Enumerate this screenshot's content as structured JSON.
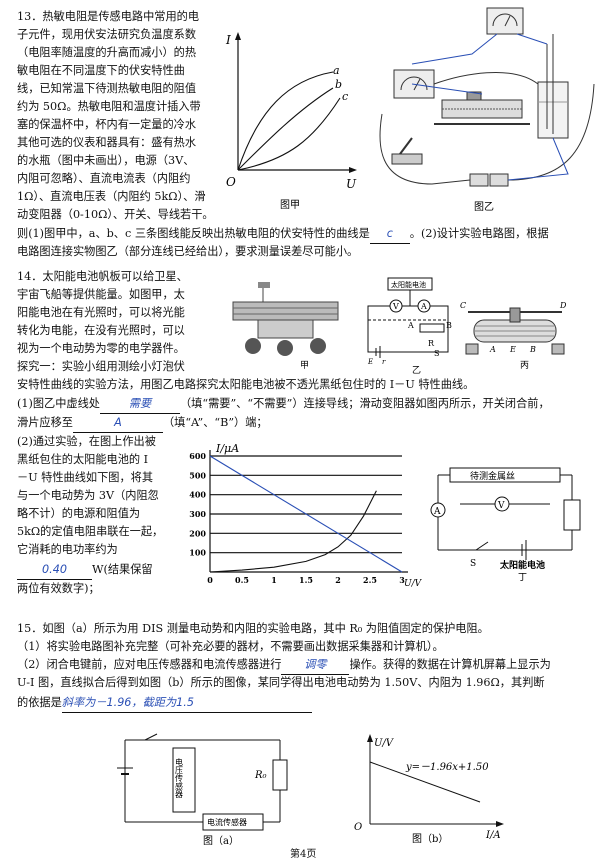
{
  "q13": {
    "lines": [
      "13．热敏电阻是传感电路中常用的电",
      "子元件，现用伏安法研究负温度系数",
      "（电阻率随温度的升高而减小）的热",
      "敏电阻在不同温度下的伏安特性曲",
      "线，已知常温下待测热敏电阻的阻值",
      "约为 50Ω。热敏电阻和温度计插入带",
      "塞的保温杯中，杯内有一定量的冷水",
      "其他可选的仪表和器具有：盛有热水",
      "的水瓶（图中未画出），电源（3V、",
      "内阻可忽略）、直流电流表（内阻约",
      "1Ω）、直流电压表（内阻约 5kΩ）、滑",
      "动变阻器（0-10Ω）、开关、导线若干。"
    ],
    "line13a": "则(1)图甲中，a、b、c 三条图线能反映出热敏电阻的伏安特性的曲线是",
    "answer1": "c",
    "line13a_tail": "。(2)设计实验电路图，根据",
    "line13b": "电路图连接实物图乙（部分连线已经给出），要求测量误差尽可能小。",
    "fig_jia": {
      "ylabel": "I",
      "xlabel": "U",
      "origin": "O",
      "curve_a": "a",
      "curve_b": "b",
      "curve_c": "c",
      "caption": "图甲"
    },
    "fig_yi": {
      "caption": "图乙"
    }
  },
  "q14": {
    "lines": [
      "14．太阳能电池帆板可以给卫星、",
      "宇宙飞船等提供能量。如图甲，太",
      "阳能电池在有光照时，可以将光能",
      "转化为电能，在没有光照时，可以",
      "视为一个电动势为零的电学器件。",
      "探究一：实验小组用测绘小灯泡伏"
    ],
    "line_full": "安特性曲线的实验方法，用图乙电路探究太阳能电池被不透光黑纸包住时的 I－U 特性曲线。",
    "p1_a": "(1)图乙中虚线处",
    "p1_ans": "需要",
    "p1_b": "（填“需要”、“不需要”）连接导线；滑动变阻器如图丙所示，开关闭合前，",
    "p1_c": "滑片应移至",
    "p1_ans2": "A",
    "p1_d": "（填“A”、“B”）端；",
    "p2_lines": [
      "(2)通过实验，在图上作出被",
      "黑纸包住的太阳能电池的 I",
      "－U 特性曲线如下图，将其",
      "与一个电动势为 3V（内阻忽",
      "略不计）的电源和阻值为",
      "5kΩ的定值电阻串联在一起，",
      "它消耗的电功率约为"
    ],
    "p2_ans": "0.40",
    "p2_tail": "W(结果保留",
    "p2_last": "两位有效数字)；",
    "fig_labels": {
      "jia": "甲",
      "yi": "乙",
      "bing": "丙",
      "ding": "丁",
      "box_title": "太阳能电池",
      "wire_title": "待测金属丝",
      "solar": "太阳能电池",
      "S": "S",
      "R": "R",
      "E": "E",
      "r": "r",
      "A": "A",
      "B": "B",
      "C": "C",
      "D": "D",
      "V": "V",
      "Am": "A"
    },
    "chart_labels": {
      "ylabel": "I/μA",
      "xlabel": "U/V",
      "origin": "0"
    }
  },
  "chart_data": {
    "type": "line",
    "title": "",
    "xlabel": "U/V",
    "ylabel": "I/μA",
    "xlim": [
      0,
      3
    ],
    "ylim": [
      0,
      600
    ],
    "xticks": [
      "0",
      "0.5",
      "1",
      "1.5",
      "2",
      "2.5",
      "3"
    ],
    "yticks": [
      "100",
      "200",
      "300",
      "400",
      "500",
      "600"
    ],
    "grid": true,
    "series": [
      {
        "values_x": [
          0,
          0.5,
          1.0,
          1.5,
          1.8,
          2.0,
          2.2,
          2.4,
          2.6
        ],
        "values_y": [
          0,
          10,
          25,
          55,
          90,
          130,
          190,
          290,
          420
        ]
      },
      {
        "values_x": [
          0,
          3
        ],
        "values_y": [
          600,
          0
        ]
      }
    ]
  },
  "q15": {
    "line1": "15．如图（a）所示为用 DIS 测量电动势和内阻的实验电路，其中 R₀ 为阻值固定的保护电阻。",
    "line2": "（1）将实验电路图补充完整（可补充必要的器材，不需要画出数据采集器和计算机）。",
    "line3a": "（2）闭合电键前，应对电压传感器和电流传感器进行",
    "line3ans": "调零",
    "line3b": "操作。获得的数据在计算机屏幕上显示为",
    "line4": "U-I 图，直线拟合后得到如图（b）所示的图像，某同学得出电池电动势为 1.50V、内阻为 1.96Ω，其判断",
    "line5": "的依据是",
    "line5ans": "斜率为－1.96，截距为1.5",
    "fig_a": {
      "voltage_sensor": "电压传感器",
      "current_sensor": "电流传感器",
      "R0": "R₀",
      "caption": "图（a）"
    },
    "fig_b": {
      "ylabel": "U/V",
      "xlabel": "I/A",
      "origin": "O",
      "equation": "y=－1.96x+1.50",
      "caption": "图（b）"
    }
  },
  "footer": {
    "page": "第4页"
  }
}
